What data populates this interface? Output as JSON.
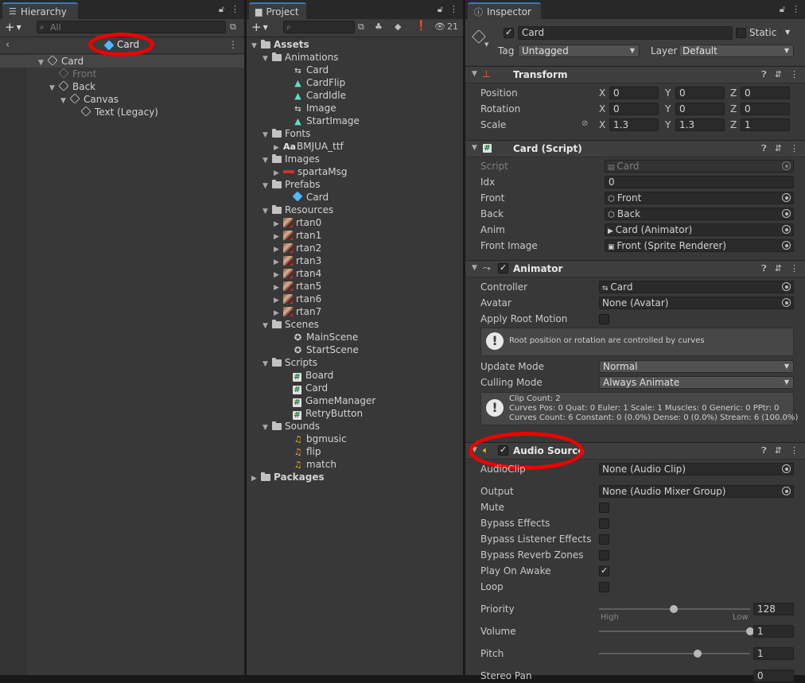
{
  "hierarchy": {
    "tab_label": "Hierarchy",
    "search_placeholder": "All",
    "scene_header": "Card",
    "tree": [
      {
        "label": "Card",
        "depth": 0,
        "arrow": "▼",
        "dim": false
      },
      {
        "label": "Front",
        "depth": 1,
        "arrow": "",
        "dim": true
      },
      {
        "label": "Back",
        "depth": 1,
        "arrow": "▼",
        "dim": false
      },
      {
        "label": "Canvas",
        "depth": 2,
        "arrow": "▼",
        "dim": false
      },
      {
        "label": "Text (Legacy)",
        "depth": 3,
        "arrow": "",
        "dim": false
      }
    ]
  },
  "project": {
    "tab_label": "Project",
    "hidden_count": "21",
    "tree": [
      {
        "label": "Assets",
        "depth": 0,
        "arrow": "▼",
        "icon": "folder",
        "bold": true
      },
      {
        "label": "Animations",
        "depth": 1,
        "arrow": "▼",
        "icon": "folder"
      },
      {
        "label": "Card",
        "depth": 2,
        "arrow": "",
        "icon": "animator-controller"
      },
      {
        "label": "CardFlip",
        "depth": 2,
        "arrow": "",
        "icon": "animation-clip"
      },
      {
        "label": "CardIdle",
        "depth": 2,
        "arrow": "",
        "icon": "animation-clip"
      },
      {
        "label": "Image",
        "depth": 2,
        "arrow": "",
        "icon": "animator-controller"
      },
      {
        "label": "StartImage",
        "depth": 2,
        "arrow": "",
        "icon": "animation-clip"
      },
      {
        "label": "Fonts",
        "depth": 1,
        "arrow": "▼",
        "icon": "folder"
      },
      {
        "label": "BMJUA_ttf",
        "depth": 2,
        "arrow": "▶",
        "icon": "font"
      },
      {
        "label": "Images",
        "depth": 1,
        "arrow": "▼",
        "icon": "folder"
      },
      {
        "label": "spartaMsg",
        "depth": 2,
        "arrow": "▶",
        "icon": "sparta"
      },
      {
        "label": "Prefabs",
        "depth": 1,
        "arrow": "▼",
        "icon": "folder"
      },
      {
        "label": "Card",
        "depth": 2,
        "arrow": "",
        "icon": "prefab"
      },
      {
        "label": "Resources",
        "depth": 1,
        "arrow": "▼",
        "icon": "folder"
      },
      {
        "label": "rtan0",
        "depth": 2,
        "arrow": "▶",
        "icon": "sprite"
      },
      {
        "label": "rtan1",
        "depth": 2,
        "arrow": "▶",
        "icon": "sprite"
      },
      {
        "label": "rtan2",
        "depth": 2,
        "arrow": "▶",
        "icon": "sprite"
      },
      {
        "label": "rtan3",
        "depth": 2,
        "arrow": "▶",
        "icon": "sprite"
      },
      {
        "label": "rtan4",
        "depth": 2,
        "arrow": "▶",
        "icon": "sprite"
      },
      {
        "label": "rtan5",
        "depth": 2,
        "arrow": "▶",
        "icon": "sprite"
      },
      {
        "label": "rtan6",
        "depth": 2,
        "arrow": "▶",
        "icon": "sprite"
      },
      {
        "label": "rtan7",
        "depth": 2,
        "arrow": "▶",
        "icon": "sprite"
      },
      {
        "label": "Scenes",
        "depth": 1,
        "arrow": "▼",
        "icon": "folder"
      },
      {
        "label": "MainScene",
        "depth": 2,
        "arrow": "",
        "icon": "scene"
      },
      {
        "label": "StartScene",
        "depth": 2,
        "arrow": "",
        "icon": "scene"
      },
      {
        "label": "Scripts",
        "depth": 1,
        "arrow": "▼",
        "icon": "folder"
      },
      {
        "label": "Board",
        "depth": 2,
        "arrow": "",
        "icon": "script"
      },
      {
        "label": "Card",
        "depth": 2,
        "arrow": "",
        "icon": "script"
      },
      {
        "label": "GameManager",
        "depth": 2,
        "arrow": "",
        "icon": "script"
      },
      {
        "label": "RetryButton",
        "depth": 2,
        "arrow": "",
        "icon": "script"
      },
      {
        "label": "Sounds",
        "depth": 1,
        "arrow": "▼",
        "icon": "folder"
      },
      {
        "label": "bgmusic",
        "depth": 2,
        "arrow": "",
        "icon": "audio"
      },
      {
        "label": "flip",
        "depth": 2,
        "arrow": "",
        "icon": "audio"
      },
      {
        "label": "match",
        "depth": 2,
        "arrow": "",
        "icon": "audio"
      },
      {
        "label": "Packages",
        "depth": 0,
        "arrow": "▶",
        "icon": "folder",
        "bold": true
      }
    ]
  },
  "inspector": {
    "tab_label": "Inspector",
    "object_name": "Card",
    "static_label": "Static",
    "tag_label": "Tag",
    "tag_value": "Untagged",
    "layer_label": "Layer",
    "layer_value": "Default",
    "transform": {
      "title": "Transform",
      "position_label": "Position",
      "rotation_label": "Rotation",
      "scale_label": "Scale",
      "x": "X",
      "y": "Y",
      "z": "Z",
      "position": [
        "0",
        "0",
        "0"
      ],
      "rotation": [
        "0",
        "0",
        "0"
      ],
      "scale": [
        "1.3",
        "1.3",
        "1"
      ]
    },
    "card_script": {
      "title": "Card (Script)",
      "script_label": "Script",
      "script_value": "Card",
      "idx_label": "Idx",
      "idx_value": "0",
      "front_label": "Front",
      "front_value": "Front",
      "back_label": "Back",
      "back_value": "Back",
      "anim_label": "Anim",
      "anim_value": "Card (Animator)",
      "frontimage_label": "Front Image",
      "frontimage_value": "Front (Sprite Renderer)"
    },
    "animator": {
      "title": "Animator",
      "controller_label": "Controller",
      "controller_value": "Card",
      "avatar_label": "Avatar",
      "avatar_value": "None (Avatar)",
      "rootmotion_label": "Apply Root Motion",
      "info1": "Root position or rotation are controlled by curves",
      "update_label": "Update Mode",
      "update_value": "Normal",
      "culling_label": "Culling Mode",
      "culling_value": "Always Animate",
      "info2_line1": "Clip Count: 2",
      "info2_line2": "Curves Pos: 0 Quat: 0 Euler: 1 Scale: 1 Muscles: 0 Generic: 0 PPtr: 0",
      "info2_line3": "Curves Count: 6 Constant: 0 (0.0%) Dense: 0 (0.0%) Stream: 6 (100.0%)"
    },
    "audio": {
      "title": "Audio Source",
      "clip_label": "AudioClip",
      "clip_value": "None (Audio Clip)",
      "output_label": "Output",
      "output_value": "None (Audio Mixer Group)",
      "mute_label": "Mute",
      "bypass_label": "Bypass Effects",
      "bypass_listener_label": "Bypass Listener Effects",
      "bypass_reverb_label": "Bypass Reverb Zones",
      "playonawake_label": "Play On Awake",
      "loop_label": "Loop",
      "priority_label": "Priority",
      "priority_value": "128",
      "priority_level": 0.495,
      "high_label": "High",
      "low_label": "Low",
      "volume_label": "Volume",
      "volume_value": "1",
      "volume_level": 1.0,
      "pitch_label": "Pitch",
      "pitch_value": "1",
      "pitch_level": 0.65,
      "stereo_label": "Stereo Pan",
      "stereo_value": "0"
    }
  },
  "colors": {
    "annotation_red": "#f00000",
    "tab_accent": "#3a79bb"
  }
}
